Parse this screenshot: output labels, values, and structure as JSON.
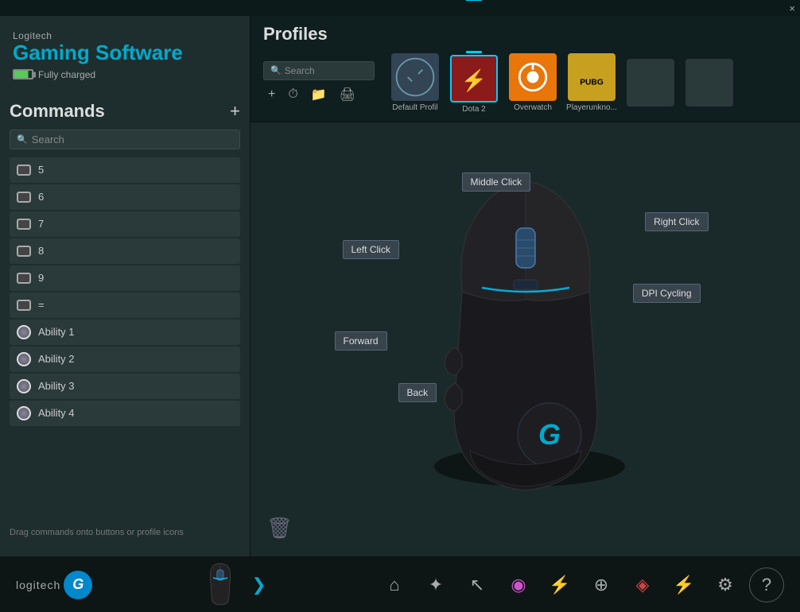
{
  "app": {
    "brand": "Logitech",
    "title": "Gaming Software",
    "battery": "Fully charged",
    "close_btn": "×"
  },
  "commands": {
    "title": "Commands",
    "add_btn": "+",
    "search_placeholder": "Search",
    "drag_hint": "Drag commands onto buttons or profile icons",
    "items": [
      {
        "id": "cmd-5",
        "label": "5",
        "type": "key"
      },
      {
        "id": "cmd-6",
        "label": "6",
        "type": "key"
      },
      {
        "id": "cmd-7",
        "label": "7",
        "type": "key"
      },
      {
        "id": "cmd-8",
        "label": "8",
        "type": "key"
      },
      {
        "id": "cmd-9",
        "label": "9",
        "type": "key"
      },
      {
        "id": "cmd-eq",
        "label": "=",
        "type": "key"
      },
      {
        "id": "cmd-ab1",
        "label": "Ability 1",
        "type": "ability"
      },
      {
        "id": "cmd-ab2",
        "label": "Ability 2",
        "type": "ability"
      },
      {
        "id": "cmd-ab3",
        "label": "Ability 3",
        "type": "ability"
      },
      {
        "id": "cmd-ab4",
        "label": "Ability 4",
        "type": "ability"
      }
    ]
  },
  "profiles": {
    "title": "Profiles",
    "search_placeholder": "Search",
    "items": [
      {
        "id": "p1",
        "label": "Default Profil",
        "type": "default",
        "active": false
      },
      {
        "id": "p2",
        "label": "Dota 2",
        "type": "dota",
        "active": true
      },
      {
        "id": "p3",
        "label": "Overwatch",
        "type": "overwatch",
        "active": false
      },
      {
        "id": "p4",
        "label": "Playerunkno...",
        "type": "pubg",
        "active": false
      },
      {
        "id": "p5",
        "label": "",
        "type": "empty",
        "active": false
      },
      {
        "id": "p6",
        "label": "",
        "type": "empty",
        "active": false
      }
    ],
    "toolbar": {
      "add": "+",
      "history": "⏱",
      "folder": "📁",
      "print": "🖨"
    }
  },
  "mouse_labels": {
    "middle_click": "Middle Click",
    "right_click": "Right Click",
    "left_click": "Left Click",
    "dpi_cycling": "DPI Cycling",
    "forward": "Forward",
    "back": "Back"
  },
  "bottom_bar": {
    "logo_text": "logitech",
    "logo_g": "G",
    "arrow": "❯",
    "icons": [
      {
        "name": "home-icon",
        "symbol": "⌂"
      },
      {
        "name": "effects-icon",
        "symbol": "✦"
      },
      {
        "name": "pointer-icon",
        "symbol": "↖"
      },
      {
        "name": "color-icon",
        "symbol": "◉"
      },
      {
        "name": "battery-icon",
        "symbol": "⚡"
      },
      {
        "name": "crosshair-icon",
        "symbol": "⊕"
      },
      {
        "name": "spectrum-icon",
        "symbol": "◈"
      },
      {
        "name": "lightning-icon",
        "symbol": "⚡"
      },
      {
        "name": "settings-icon",
        "symbol": "⚙"
      },
      {
        "name": "help-icon",
        "symbol": "?"
      }
    ]
  }
}
